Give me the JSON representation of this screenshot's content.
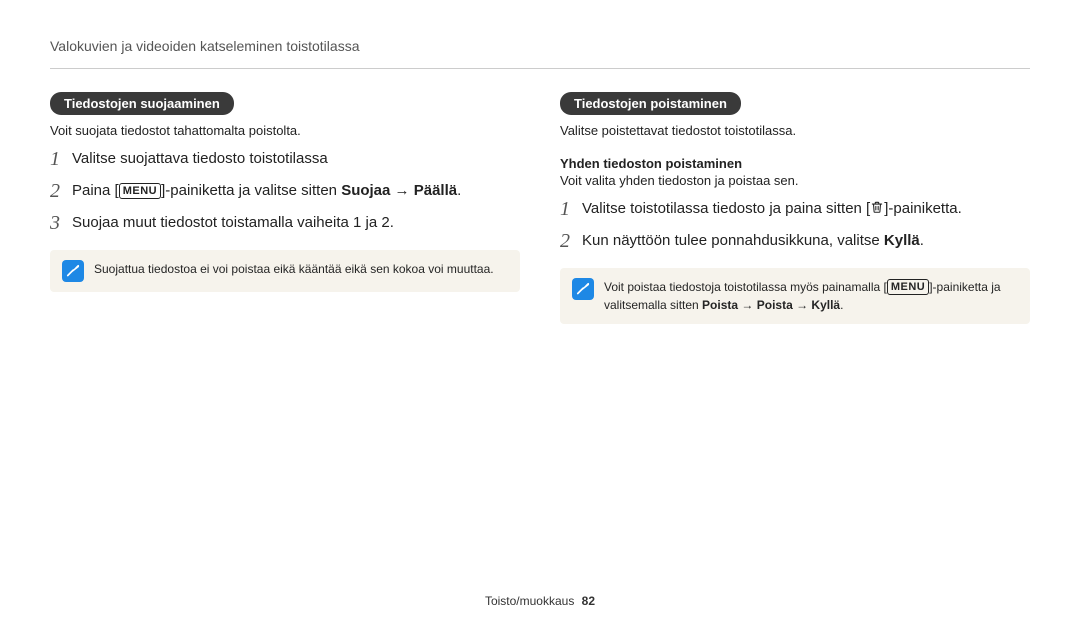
{
  "header": {
    "title": "Valokuvien ja videoiden katseleminen toistotilassa"
  },
  "left": {
    "pill": "Tiedostojen suojaaminen",
    "lead": "Voit suojata tiedostot tahattomalta poistolta.",
    "steps": {
      "s1_num": "1",
      "s1_text": "Valitse suojattava tiedosto toistotilassa",
      "s2_num": "2",
      "s2_pre": "Paina [",
      "s2_menu": "MENU",
      "s2_mid": "]-painiketta ja valitse sitten ",
      "s2_b1": "Suojaa",
      "s2_arrow": " → ",
      "s2_b2": "Päällä",
      "s2_post": ".",
      "s3_num": "3",
      "s3_text": "Suojaa muut tiedostot toistamalla vaiheita 1 ja 2."
    },
    "note": "Suojattua tiedostoa ei voi poistaa eikä kääntää eikä sen kokoa voi muuttaa."
  },
  "right": {
    "pill": "Tiedostojen poistaminen",
    "lead": "Valitse poistettavat tiedostot toistotilassa.",
    "sub_heading": "Yhden tiedoston poistaminen",
    "sub_lead": "Voit valita yhden tiedoston ja poistaa sen.",
    "steps": {
      "s1_num": "1",
      "s1_pre": "Valitse toistotilassa tiedosto ja paina sitten [",
      "s1_post": "]-painiketta.",
      "s2_num": "2",
      "s2_pre": "Kun näyttöön tulee ponnahdusikkuna, valitse ",
      "s2_b": "Kyllä",
      "s2_post": "."
    },
    "note": {
      "pre": "Voit poistaa tiedostoja toistotilassa myös painamalla [",
      "menu": "MENU",
      "mid": "]-painiketta ja valitsemalla sitten ",
      "b1": "Poista",
      "arrow1": " → ",
      "b2": "Poista",
      "arrow2": " → ",
      "b3": "Kyllä",
      "post": "."
    }
  },
  "footer": {
    "section": "Toisto/muokkaus",
    "page": "82"
  }
}
